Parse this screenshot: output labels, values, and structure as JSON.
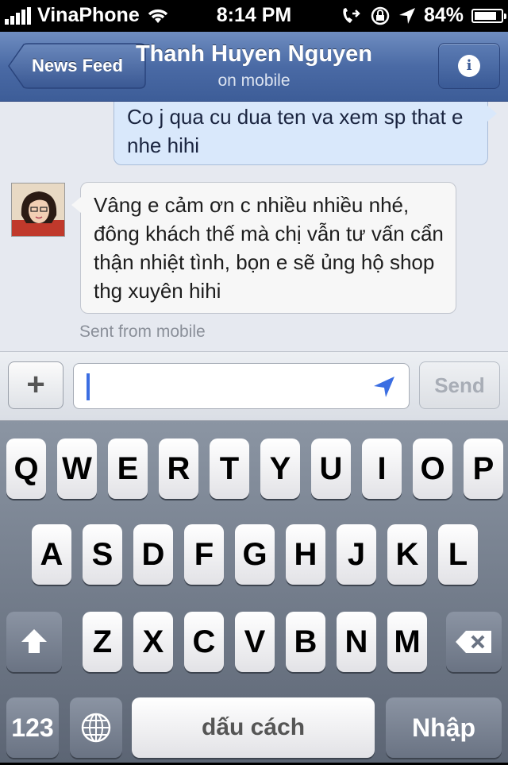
{
  "status": {
    "carrier": "VinaPhone",
    "time": "8:14 PM",
    "battery_text": "84%",
    "battery_level": 0.84
  },
  "nav": {
    "back_label": "News Feed",
    "title": "Thanh Huyen Nguyen",
    "subtitle": "on mobile"
  },
  "messages": {
    "outgoing": "Co j qua cu dua ten va xem sp that e nhe hihi",
    "incoming": "Vâng e cảm ơn c nhiều nhiều nhé, đông khách thế mà chị vẫn tư vấn cẩn thận nhiệt tình, bọn e sẽ ủng hộ shop thg xuyên hihi",
    "sent_from": "Sent from mobile"
  },
  "composer": {
    "plus_label": "+",
    "send_label": "Send",
    "input_value": ""
  },
  "keyboard": {
    "row1": [
      "Q",
      "W",
      "E",
      "R",
      "T",
      "Y",
      "U",
      "I",
      "O",
      "P"
    ],
    "row2": [
      "A",
      "S",
      "D",
      "F",
      "G",
      "H",
      "J",
      "K",
      "L"
    ],
    "row3": [
      "Z",
      "X",
      "C",
      "V",
      "B",
      "N",
      "M"
    ],
    "numbers_label": "123",
    "space_label": "dấu cách",
    "return_label": "Nhập"
  },
  "colors": {
    "navbar": "#4a6aa5",
    "outgoing_bubble": "#d9e8fb",
    "caret": "#3b6ee2"
  }
}
